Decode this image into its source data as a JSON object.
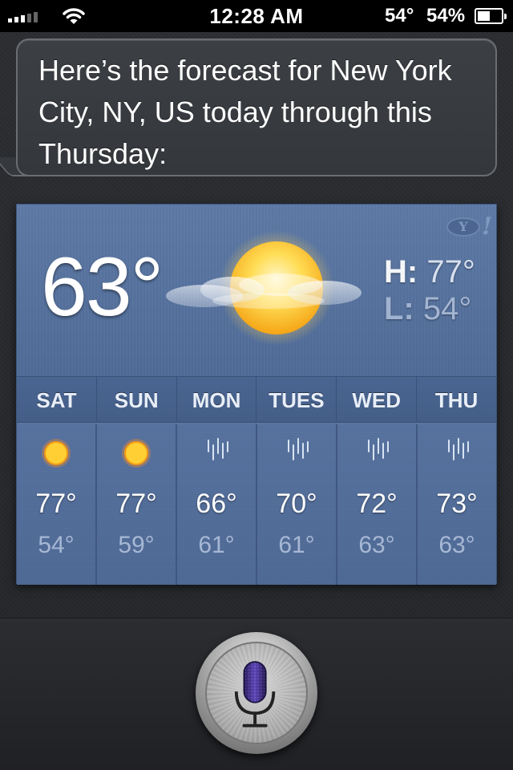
{
  "status_bar": {
    "time": "12:28 AM",
    "temperature": "54°",
    "battery_percent": "54%",
    "battery_level": 0.54
  },
  "siri": {
    "response": "Here’s the forecast for New York City, NY, US today through this Thursday:"
  },
  "weather": {
    "current_temp": "63°",
    "high_label": "H:",
    "high_value": "77°",
    "low_label": "L:",
    "low_value": "54°",
    "current_condition_icon": "partly-sunny-icon",
    "days": [
      {
        "day": "SAT",
        "icon": "sun-icon",
        "high": "77°",
        "low": "54°"
      },
      {
        "day": "SUN",
        "icon": "sun-icon",
        "high": "77°",
        "low": "59°"
      },
      {
        "day": "MON",
        "icon": "rain-icon",
        "high": "66°",
        "low": "61°"
      },
      {
        "day": "TUES",
        "icon": "rain-icon",
        "high": "70°",
        "low": "61°"
      },
      {
        "day": "WED",
        "icon": "rain-icon",
        "high": "72°",
        "low": "63°"
      },
      {
        "day": "THU",
        "icon": "rain-icon",
        "high": "73°",
        "low": "63°"
      }
    ],
    "provider_icon": "yahoo-icon"
  },
  "colors": {
    "card_blue": "#5f7aa6",
    "sun": "#ffd23a"
  }
}
